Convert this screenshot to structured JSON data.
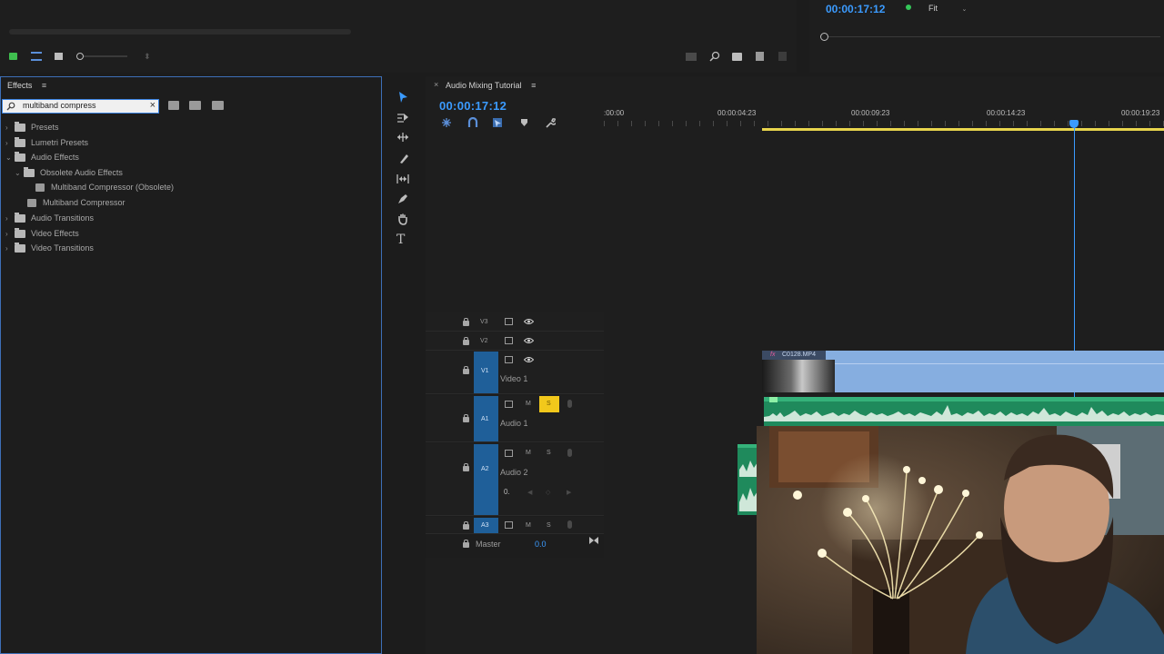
{
  "program_monitor": {
    "timecode": "00:00:17:12",
    "zoom": "Fit"
  },
  "effects_panel": {
    "title": "Effects",
    "search_value": "multiband compress",
    "tree": [
      {
        "label": "Presets",
        "kind": "folder",
        "depth": 0
      },
      {
        "label": "Lumetri Presets",
        "kind": "folder",
        "depth": 0
      },
      {
        "label": "Audio Effects",
        "kind": "folder",
        "depth": 0,
        "open": true
      },
      {
        "label": "Obsolete Audio Effects",
        "kind": "folder",
        "depth": 1,
        "open": true
      },
      {
        "label": "Multiband Compressor (Obsolete)",
        "kind": "effect",
        "depth": 2
      },
      {
        "label": "Multiband Compressor",
        "kind": "effect",
        "depth": 1
      },
      {
        "label": "Audio Transitions",
        "kind": "folder",
        "depth": 0
      },
      {
        "label": "Video Effects",
        "kind": "folder",
        "depth": 0
      },
      {
        "label": "Video Transitions",
        "kind": "folder",
        "depth": 0
      }
    ]
  },
  "timeline": {
    "sequence_name": "Audio Mixing Tutorial",
    "timecode": "00:00:17:12",
    "ruler": [
      ":00:00",
      "00:00:04:23",
      "00:00:09:23",
      "00:00:14:23",
      "00:00:19:23"
    ],
    "tracks": {
      "v3": "V3",
      "v2": "V2",
      "v1": "V1",
      "v1_name": "Video 1",
      "a1": "A1",
      "a1_name": "Audio 1",
      "a2": "A2",
      "a2_name": "Audio 2",
      "a3": "A3",
      "master": "Master",
      "master_value": "0.0",
      "mute": "M",
      "solo": "S",
      "pan": "0."
    },
    "clip_name": "C0128.MP4",
    "clip_fx": "fx"
  },
  "colors": {
    "accent": "#3b9bff",
    "track_blue": "#1f5f99",
    "solo_active": "#f2c81b",
    "audio_clip": "#1f8a5c",
    "video_clip": "#86aee0"
  }
}
